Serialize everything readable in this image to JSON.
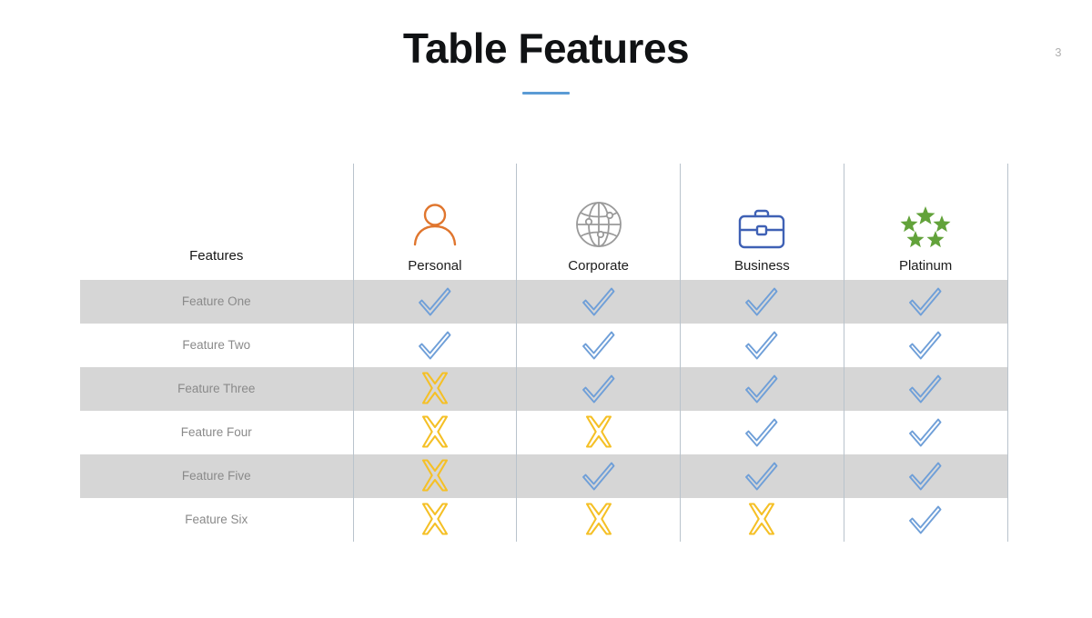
{
  "slide": {
    "number": "3",
    "title": "Table Features"
  },
  "colors": {
    "accent_rule": "#5b9bd5",
    "check": "#6f9fd8",
    "cross": "#f5c026",
    "personal_icon": "#e0762e",
    "corporate_icon": "#9a9a9a",
    "business_icon": "#3f61b5",
    "platinum_icon": "#62a23a",
    "stripe": "#d6d6d6",
    "grid_line": "#b9c3cc",
    "row_label": "#8a8a8a",
    "title_text": "#101214"
  },
  "table": {
    "feature_column_header": "Features",
    "columns": [
      {
        "label": "Personal",
        "icon": "user-icon"
      },
      {
        "label": "Corporate",
        "icon": "globe-icon"
      },
      {
        "label": "Business",
        "icon": "briefcase-icon"
      },
      {
        "label": "Platinum",
        "icon": "five-stars-icon"
      }
    ],
    "rows": [
      {
        "label": "Feature One",
        "striped": true,
        "values": [
          "check",
          "check",
          "check",
          "check"
        ]
      },
      {
        "label": "Feature Two",
        "striped": false,
        "values": [
          "check",
          "check",
          "check",
          "check"
        ]
      },
      {
        "label": "Feature Three",
        "striped": true,
        "values": [
          "cross",
          "check",
          "check",
          "check"
        ]
      },
      {
        "label": "Feature Four",
        "striped": false,
        "values": [
          "cross",
          "cross",
          "check",
          "check"
        ]
      },
      {
        "label": "Feature Five",
        "striped": true,
        "values": [
          "cross",
          "check",
          "check",
          "check"
        ]
      },
      {
        "label": "Feature Six",
        "striped": false,
        "values": [
          "cross",
          "cross",
          "cross",
          "check"
        ]
      }
    ],
    "mark_labels": {
      "check": "included",
      "cross": "not-included"
    }
  }
}
